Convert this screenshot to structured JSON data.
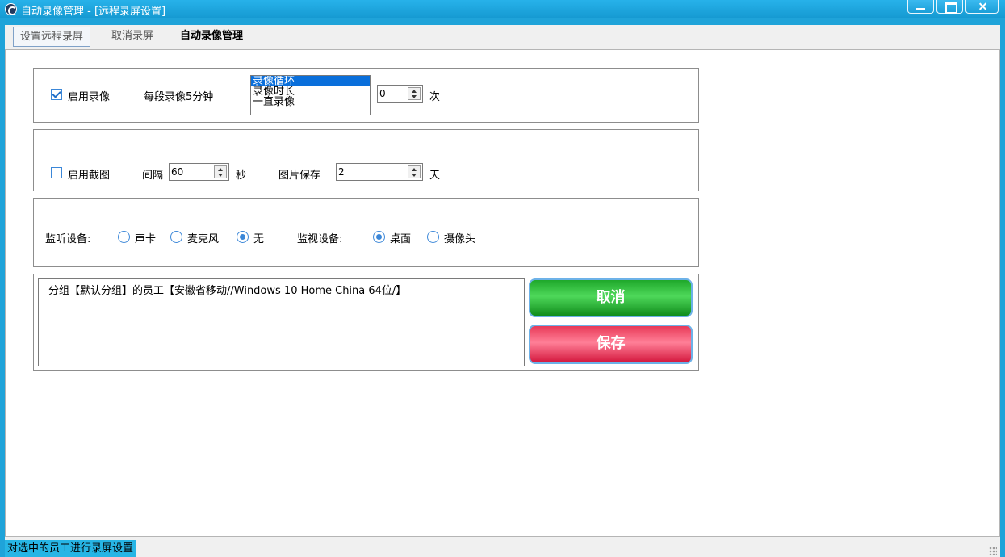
{
  "window": {
    "title": "自动录像管理 - [远程录屏设置]"
  },
  "toolbar": {
    "tabs": [
      "设置远程录屏",
      "取消录屏",
      "自动录像管理"
    ]
  },
  "record": {
    "enable_label": "启用录像",
    "enabled": true,
    "segment_label": "每段录像5分钟",
    "mode_options": [
      "录像循环",
      "录像时长",
      "一直录像"
    ],
    "selected_mode": "录像循环",
    "count_value": "0",
    "count_unit": "次"
  },
  "screenshot": {
    "enable_label": "启用截图",
    "enabled": false,
    "interval_label": "间隔",
    "interval_value": "60",
    "interval_unit": "秒",
    "keep_label": "图片保存",
    "keep_value": "2",
    "keep_unit": "天"
  },
  "devices": {
    "listen_label": "监听设备:",
    "listen_options": [
      "声卡",
      "麦克风",
      "无"
    ],
    "listen_selected": "无",
    "monitor_label": "监视设备:",
    "monitor_options": [
      "桌面",
      "摄像头"
    ],
    "monitor_selected": "桌面"
  },
  "target": {
    "text": "分组【默认分组】的员工【安徽省移动//Windows 10 Home China 64位/】"
  },
  "buttons": {
    "cancel": "取消",
    "save": "保存"
  },
  "status": {
    "text": "对选中的员工进行录屏设置"
  },
  "colors": {
    "title_bar": "#1fa3d9",
    "cancel_button": "#1fa82b",
    "save_button": "#e83a58",
    "selection": "#0a6fdb"
  }
}
